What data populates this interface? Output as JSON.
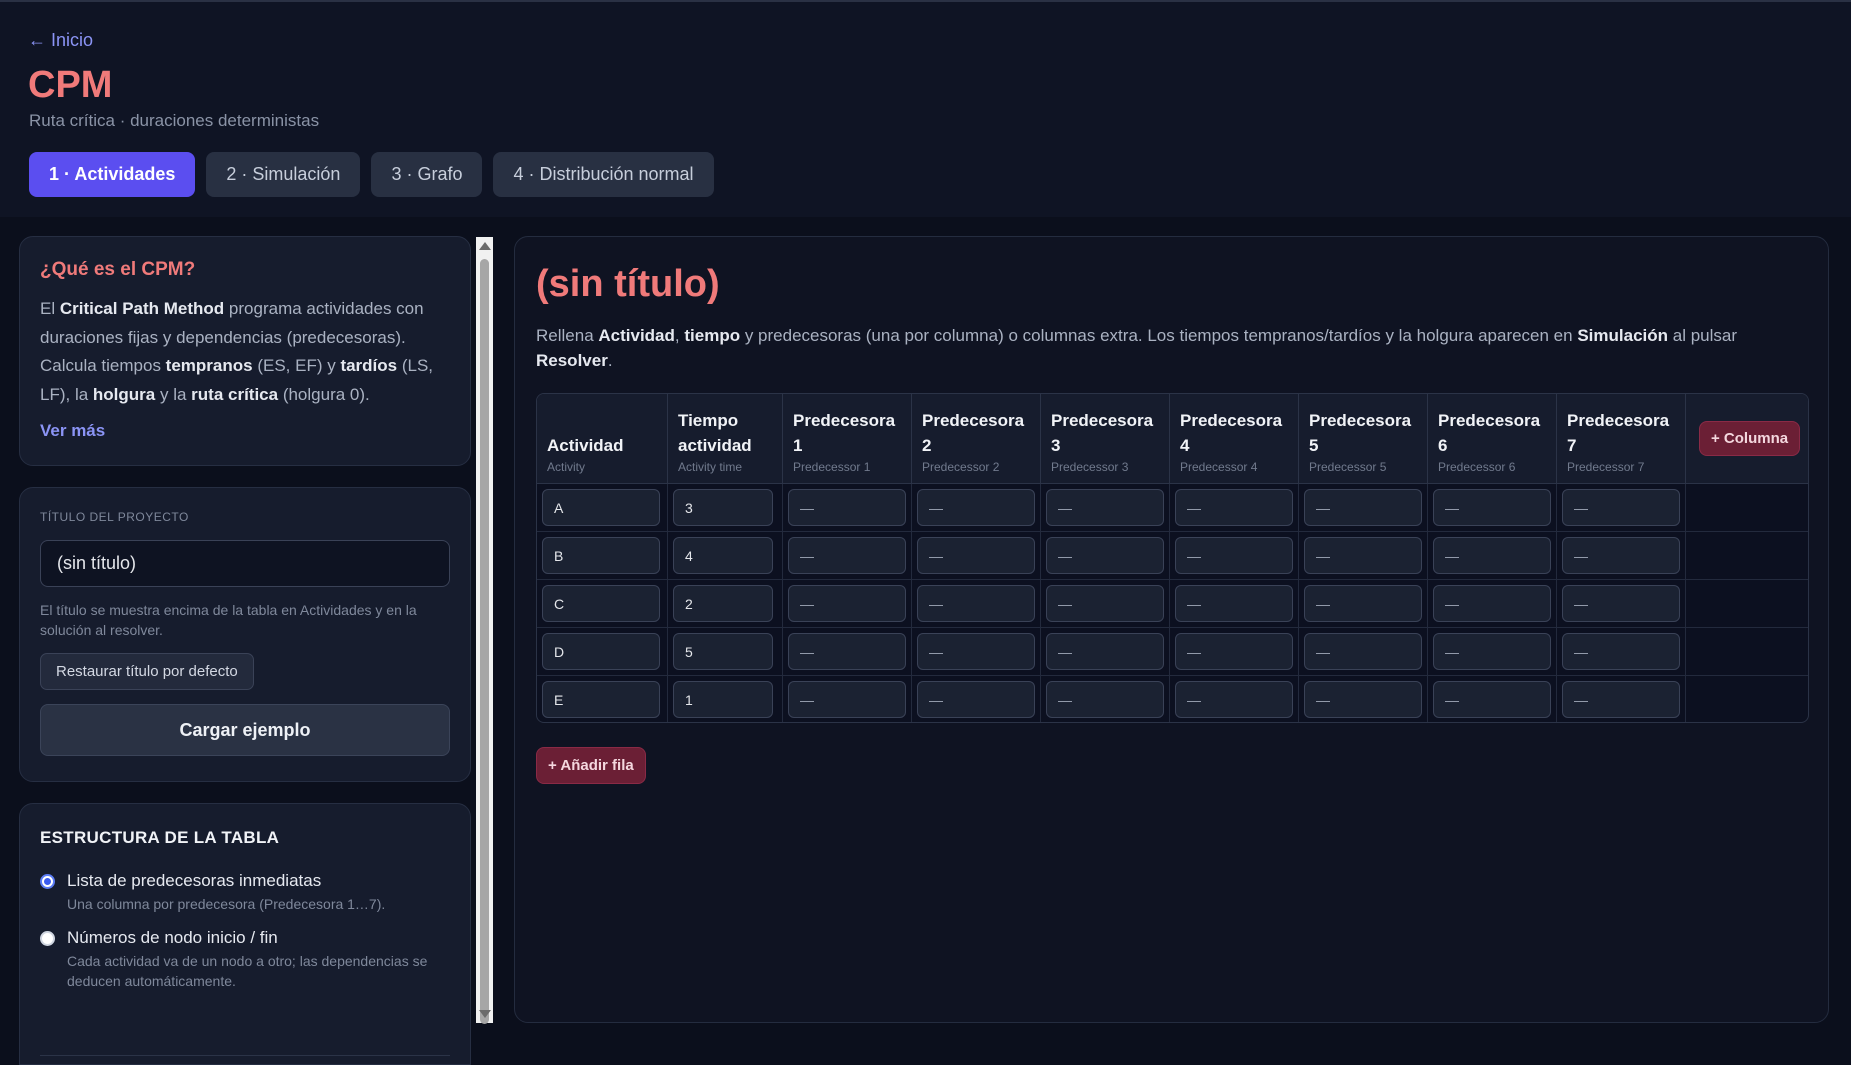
{
  "header": {
    "back_label": "← Inicio",
    "title": "CPM",
    "subtitle": "Ruta crítica · duraciones deterministas",
    "tabs": [
      "1 · Actividades",
      "2 · Simulación",
      "3 · Grafo",
      "4 · Distribución normal"
    ],
    "active_tab": 0
  },
  "info": {
    "heading": "¿Qué es el CPM?",
    "t1": "El ",
    "b1": "Critical Path Method",
    "t2": " programa actividades con duraciones fijas y dependencias (predecesoras). Calcula tiempos ",
    "b2": "tempranos",
    "t3": " (ES, EF) y ",
    "b3": "tardíos",
    "t4": " (LS, LF), la ",
    "b4": "holgura",
    "t5": " y la ",
    "b5": "ruta crítica",
    "t6": " (holgura 0).",
    "more": "Ver más"
  },
  "project": {
    "label": "Título del proyecto",
    "value": "(sin título)",
    "hint": "El título se muestra encima de la tabla en Actividades y en la solución al resolver.",
    "reset_label": "Restaurar título por defecto",
    "load_label": "Cargar ejemplo"
  },
  "structure": {
    "heading": "ESTRUCTURA DE LA TABLA",
    "opt1_label": "Lista de predecesoras inmediatas",
    "opt1_desc": "Una columna por predecesora (Predecesora 1…7).",
    "opt2_label": "Números de nodo inicio / fin",
    "opt2_desc": "Cada actividad va de un nodo a otro; las dependencias se deducen automáticamente."
  },
  "main": {
    "title": "(sin título)",
    "d1": "Rellena ",
    "db1": "Actividad",
    "d2": ", ",
    "db2": "tiempo",
    "d3": " y predecesoras (una por columna) o columnas extra. Los tiempos tempranos/tardíos y la holgura aparecen en ",
    "db3": "Simulación",
    "d4": " al pulsar ",
    "db4": "Resolver",
    "d5": ".",
    "add_col_label": "+ Columna",
    "add_row_label": "+ Añadir fila"
  },
  "table": {
    "columns": [
      {
        "l1": "Actividad",
        "l2": "",
        "sub": "Activity"
      },
      {
        "l1": "Tiempo",
        "l2": "actividad",
        "sub": "Activity time"
      },
      {
        "l1": "Predecesora",
        "l2": "1",
        "sub": "Predecessor 1"
      },
      {
        "l1": "Predecesora",
        "l2": "2",
        "sub": "Predecessor 2"
      },
      {
        "l1": "Predecesora",
        "l2": "3",
        "sub": "Predecessor 3"
      },
      {
        "l1": "Predecesora",
        "l2": "4",
        "sub": "Predecessor 4"
      },
      {
        "l1": "Predecesora",
        "l2": "5",
        "sub": "Predecessor 5"
      },
      {
        "l1": "Predecesora",
        "l2": "6",
        "sub": "Predecessor 6"
      },
      {
        "l1": "Predecesora",
        "l2": "7",
        "sub": "Predecessor 7"
      }
    ],
    "rows": [
      {
        "activity": "A",
        "time": "3",
        "preds": [
          "—",
          "—",
          "—",
          "—",
          "—",
          "—",
          "—"
        ]
      },
      {
        "activity": "B",
        "time": "4",
        "preds": [
          "—",
          "—",
          "—",
          "—",
          "—",
          "—",
          "—"
        ]
      },
      {
        "activity": "C",
        "time": "2",
        "preds": [
          "—",
          "—",
          "—",
          "—",
          "—",
          "—",
          "—"
        ]
      },
      {
        "activity": "D",
        "time": "5",
        "preds": [
          "—",
          "—",
          "—",
          "—",
          "—",
          "—",
          "—"
        ]
      },
      {
        "activity": "E",
        "time": "1",
        "preds": [
          "—",
          "—",
          "—",
          "—",
          "—",
          "—",
          "—"
        ]
      }
    ]
  }
}
